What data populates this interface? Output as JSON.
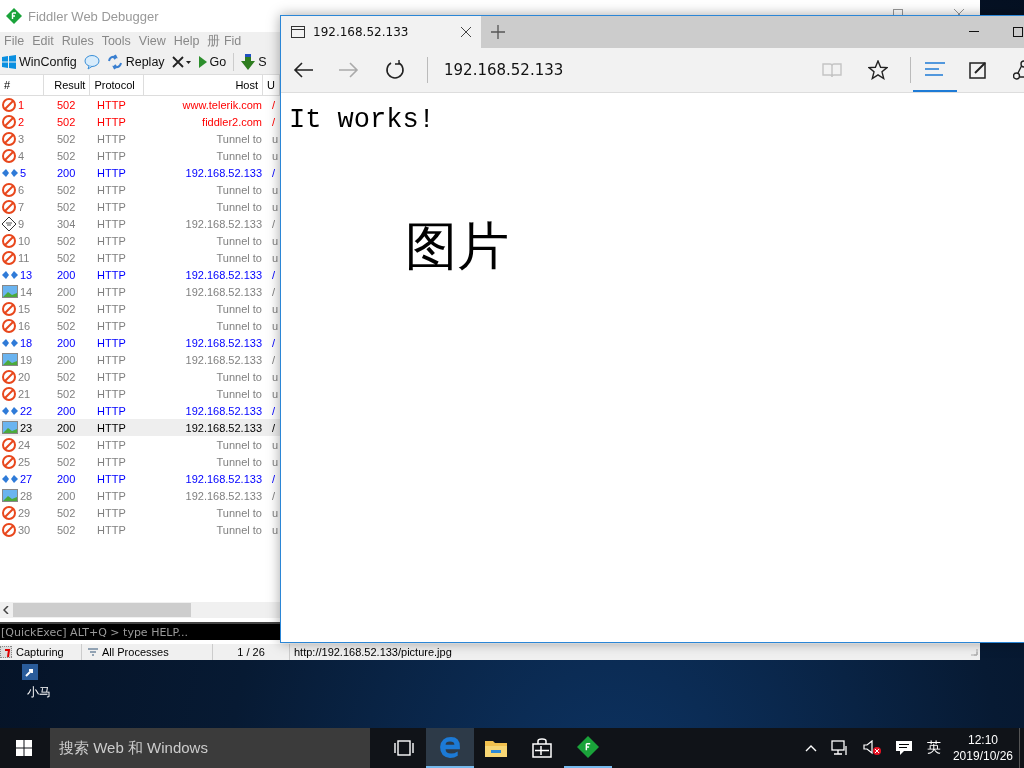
{
  "fiddler": {
    "title": "Fiddler Web Debugger",
    "menu": [
      "File",
      "Edit",
      "Rules",
      "Tools",
      "View",
      "Help",
      "册 Fid"
    ],
    "toolbar": [
      {
        "kind": "windows",
        "label": "WinConfig"
      },
      {
        "kind": "comment"
      },
      {
        "kind": "replay",
        "label": "Replay"
      },
      {
        "kind": "remove"
      },
      {
        "kind": "go",
        "label": "Go"
      },
      {
        "kind": "stream",
        "label": "S"
      }
    ],
    "columns": [
      "#",
      "Result",
      "Protocol",
      "Host",
      "U"
    ],
    "rows": [
      {
        "kind": "error",
        "num": "1",
        "result": "502",
        "protocol": "HTTP",
        "host": "www.telerik.com",
        "url": "/",
        "color": "#ff0000",
        "selected": false
      },
      {
        "kind": "error",
        "num": "2",
        "result": "502",
        "protocol": "HTTP",
        "host": "fiddler2.com",
        "url": "/",
        "color": "#ff0000",
        "selected": false
      },
      {
        "kind": "error",
        "num": "3",
        "result": "502",
        "protocol": "HTTP",
        "host": "Tunnel to",
        "url": "u",
        "color": "#808080",
        "selected": false
      },
      {
        "kind": "error",
        "num": "4",
        "result": "502",
        "protocol": "HTTP",
        "host": "Tunnel to",
        "url": "u",
        "color": "#808080",
        "selected": false
      },
      {
        "kind": "html",
        "num": "5",
        "result": "200",
        "protocol": "HTTP",
        "host": "192.168.52.133",
        "url": "/",
        "color": "#0000ff",
        "selected": false
      },
      {
        "kind": "error",
        "num": "6",
        "result": "502",
        "protocol": "HTTP",
        "host": "Tunnel to",
        "url": "u",
        "color": "#808080",
        "selected": false
      },
      {
        "kind": "error",
        "num": "7",
        "result": "502",
        "protocol": "HTTP",
        "host": "Tunnel to",
        "url": "u",
        "color": "#808080",
        "selected": false
      },
      {
        "kind": "cached",
        "num": "9",
        "result": "304",
        "protocol": "HTTP",
        "host": "192.168.52.133",
        "url": "/",
        "color": "#808080",
        "selected": false
      },
      {
        "kind": "error",
        "num": "10",
        "result": "502",
        "protocol": "HTTP",
        "host": "Tunnel to",
        "url": "u",
        "color": "#808080",
        "selected": false
      },
      {
        "kind": "error",
        "num": "11",
        "result": "502",
        "protocol": "HTTP",
        "host": "Tunnel to",
        "url": "u",
        "color": "#808080",
        "selected": false
      },
      {
        "kind": "html",
        "num": "13",
        "result": "200",
        "protocol": "HTTP",
        "host": "192.168.52.133",
        "url": "/",
        "color": "#0000ff",
        "selected": false
      },
      {
        "kind": "image",
        "num": "14",
        "result": "200",
        "protocol": "HTTP",
        "host": "192.168.52.133",
        "url": "/",
        "color": "#808080",
        "selected": false
      },
      {
        "kind": "error",
        "num": "15",
        "result": "502",
        "protocol": "HTTP",
        "host": "Tunnel to",
        "url": "u",
        "color": "#808080",
        "selected": false
      },
      {
        "kind": "error",
        "num": "16",
        "result": "502",
        "protocol": "HTTP",
        "host": "Tunnel to",
        "url": "u",
        "color": "#808080",
        "selected": false
      },
      {
        "kind": "html",
        "num": "18",
        "result": "200",
        "protocol": "HTTP",
        "host": "192.168.52.133",
        "url": "/",
        "color": "#0000ff",
        "selected": false
      },
      {
        "kind": "image",
        "num": "19",
        "result": "200",
        "protocol": "HTTP",
        "host": "192.168.52.133",
        "url": "/",
        "color": "#808080",
        "selected": false
      },
      {
        "kind": "error",
        "num": "20",
        "result": "502",
        "protocol": "HTTP",
        "host": "Tunnel to",
        "url": "u",
        "color": "#808080",
        "selected": false
      },
      {
        "kind": "error",
        "num": "21",
        "result": "502",
        "protocol": "HTTP",
        "host": "Tunnel to",
        "url": "u",
        "color": "#808080",
        "selected": false
      },
      {
        "kind": "html",
        "num": "22",
        "result": "200",
        "protocol": "HTTP",
        "host": "192.168.52.133",
        "url": "/",
        "color": "#0000ff",
        "selected": false
      },
      {
        "kind": "image",
        "num": "23",
        "result": "200",
        "protocol": "HTTP",
        "host": "192.168.52.133",
        "url": "/",
        "color": "#000000",
        "selected": true
      },
      {
        "kind": "error",
        "num": "24",
        "result": "502",
        "protocol": "HTTP",
        "host": "Tunnel to",
        "url": "u",
        "color": "#808080",
        "selected": false
      },
      {
        "kind": "error",
        "num": "25",
        "result": "502",
        "protocol": "HTTP",
        "host": "Tunnel to",
        "url": "u",
        "color": "#808080",
        "selected": false
      },
      {
        "kind": "html",
        "num": "27",
        "result": "200",
        "protocol": "HTTP",
        "host": "192.168.52.133",
        "url": "/",
        "color": "#0000ff",
        "selected": false
      },
      {
        "kind": "image",
        "num": "28",
        "result": "200",
        "protocol": "HTTP",
        "host": "192.168.52.133",
        "url": "/",
        "color": "#808080",
        "selected": false
      },
      {
        "kind": "error",
        "num": "29",
        "result": "502",
        "protocol": "HTTP",
        "host": "Tunnel to",
        "url": "u",
        "color": "#808080",
        "selected": false
      },
      {
        "kind": "error",
        "num": "30",
        "result": "502",
        "protocol": "HTTP",
        "host": "Tunnel to",
        "url": "u",
        "color": "#808080",
        "selected": false
      }
    ],
    "quickexec": {
      "placeholder": "[QuickExec] ALT+Q > type HELP..."
    },
    "status": {
      "capture": "Capturing",
      "process": "All Processes",
      "count": "1 / 26",
      "url": "http://192.168.52.133/picture.jpg"
    }
  },
  "browser": {
    "tab": {
      "title": "192.168.52.133"
    },
    "address": "192.168.52.133",
    "forward_disabled": true,
    "reading_disabled": true,
    "content": {
      "heading": "It works!",
      "alt_text": "图片"
    }
  },
  "desktop": {
    "icons": [
      {
        "label": "小马"
      }
    ]
  },
  "taskbar": {
    "search_placeholder": "搜索 Web 和 Windows",
    "apps": [
      {
        "kind": "taskview",
        "selected": false,
        "open": false
      },
      {
        "kind": "edge",
        "selected": true,
        "open": true
      },
      {
        "kind": "explorer",
        "selected": false,
        "open": false
      },
      {
        "kind": "store",
        "selected": false,
        "open": false
      },
      {
        "kind": "fiddler",
        "selected": false,
        "open": true
      }
    ],
    "ime": "英",
    "time": "12:10",
    "date": "2019/10/26"
  }
}
